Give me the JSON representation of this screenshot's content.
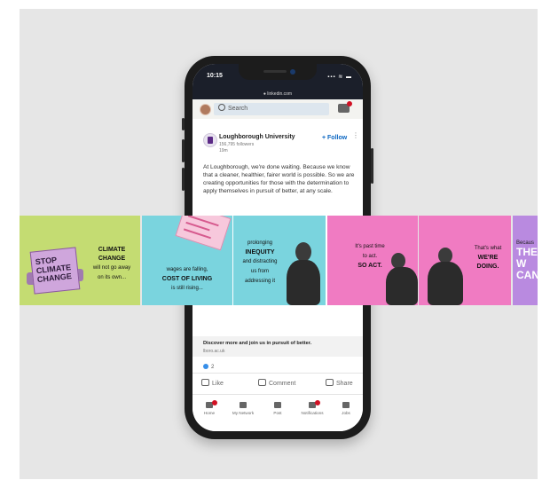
{
  "status": {
    "time": "10:15",
    "signal": "▪▪▪ ≋ ▬",
    "url": "● linkedin.com"
  },
  "topbar": {
    "search_placeholder": "Search"
  },
  "post": {
    "company": "Loughborough University",
    "followers": "156,795 followers",
    "age": "19m",
    "follow_label": "+ Follow",
    "more": "⋮",
    "text": "At Loughborough, we're done waiting. Because we know that a cleaner, healthier, fairer world is possible. So we are creating opportunities for those with the determination to apply themselves in pursuit of better, at any scale."
  },
  "cta": {
    "title": "Discover more and join us in pursuit of better.",
    "url": "lboro.ac.uk"
  },
  "reactions": {
    "count": "2"
  },
  "actions": {
    "like": "Like",
    "comment": "Comment",
    "share": "Share"
  },
  "nav": {
    "home": "Home",
    "network": "My Network",
    "post": "Post",
    "notifications": "Notifications",
    "jobs": "Jobs"
  },
  "carousel": {
    "p1": {
      "line1": "CLIMATE",
      "line2": "CHANGE",
      "line3": "will not go away",
      "line4": "on its own...",
      "sign": "STOP CLIMATE CHANGE"
    },
    "p2": {
      "line1": "wages are falling,",
      "line2": "COST OF LIVING",
      "line3": "is still rising..."
    },
    "p3": {
      "line1": "prolonging",
      "line2": "INEQUITY",
      "line3": "and distracting",
      "line4": "us from",
      "line5": "addressing it"
    },
    "p4": {
      "line1": "It's past time",
      "line2": "to act.",
      "line3": "SO ACT."
    },
    "p5": {
      "line1": "That's what",
      "line2": "WE'RE",
      "line3": "DOING."
    },
    "p6": {
      "line1": "Becaus",
      "line2": "THE W",
      "line3": "CAN"
    }
  },
  "colors": {
    "lime": "#c4dc72",
    "cyan": "#7ad4de",
    "pink": "#f07bc2",
    "purple": "#b98ae0",
    "linkedin_blue": "#0a66c2",
    "notification_red": "#d11124"
  }
}
